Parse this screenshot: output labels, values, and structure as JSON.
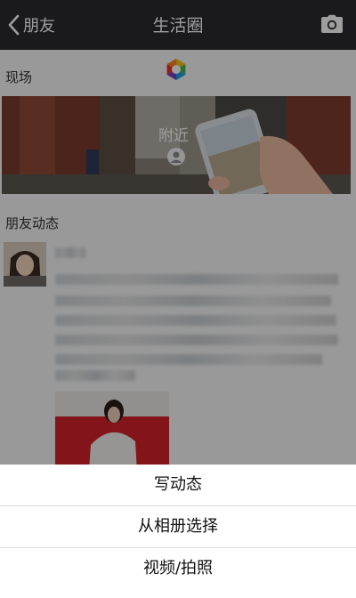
{
  "navbar": {
    "back_label": "朋友",
    "title": "生活圈"
  },
  "sections": {
    "live_label": "现场",
    "friends_label": "朋友动态"
  },
  "banner": {
    "text": "附近"
  },
  "action_sheet": {
    "items": [
      "写动态",
      "从相册选择",
      "视频/拍照"
    ]
  },
  "colors": {
    "navbar": "#2b2b2f",
    "overlay": "rgba(0,0,0,0.38)",
    "sheet": "#ffffff"
  },
  "icons": [
    "chevron-left-icon",
    "camera-icon",
    "pinwheel-icon",
    "person-icon"
  ]
}
